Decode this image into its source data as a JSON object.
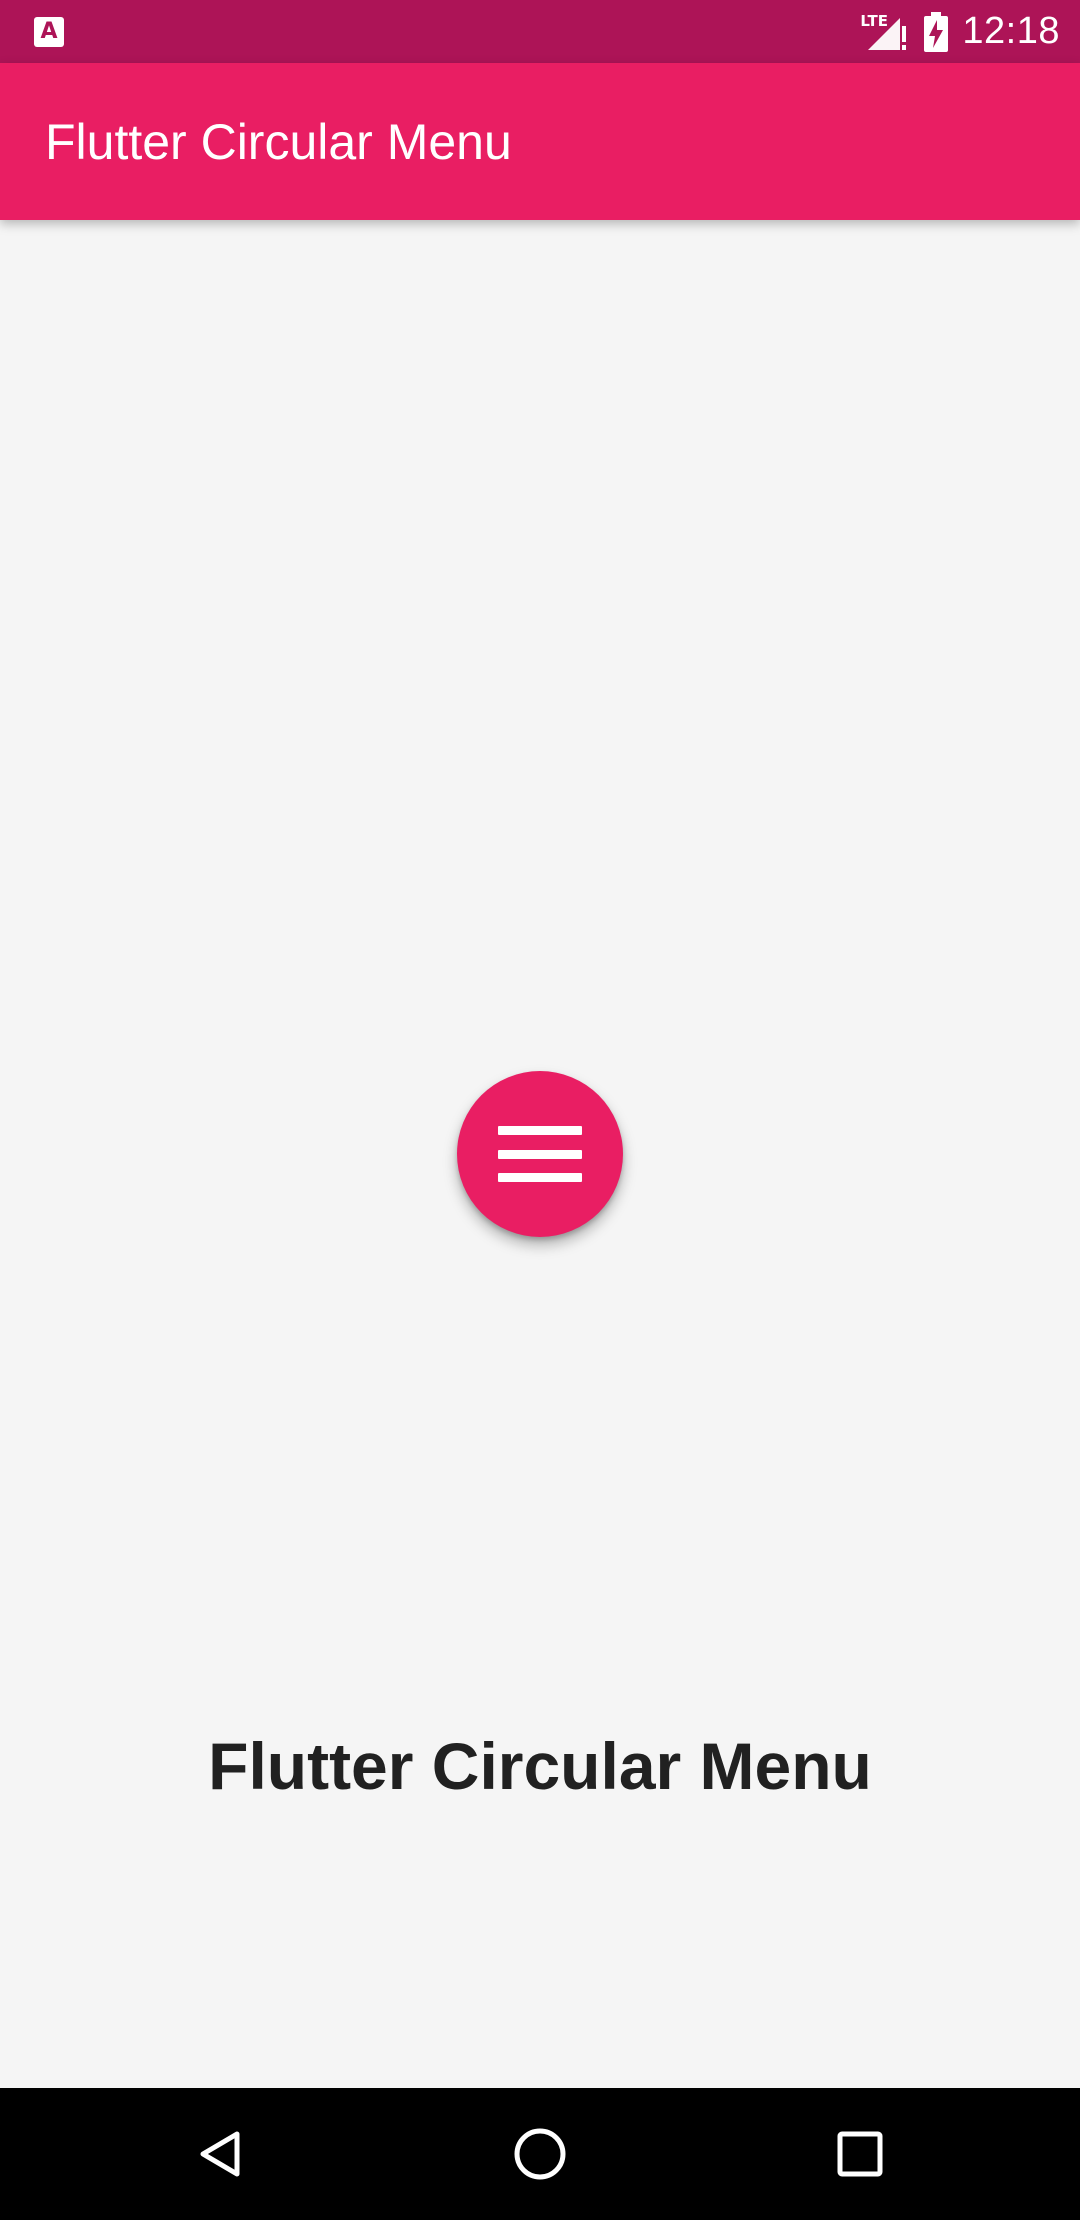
{
  "status_bar": {
    "left_icon": "a-notification-icon",
    "left_icon_glyph": "A",
    "network_label": "LTE",
    "signal_icon": "signal-icon",
    "battery_icon": "battery-charging-icon",
    "time": "12:18"
  },
  "app_bar": {
    "title": "Flutter Circular Menu"
  },
  "main": {
    "fab_icon": "menu-icon",
    "title": "Flutter Circular Menu"
  },
  "nav_bar": {
    "back_icon": "back-icon",
    "home_icon": "home-icon",
    "recents_icon": "recents-icon"
  },
  "colors": {
    "status_bar": "#ad1457",
    "primary": "#e91e63",
    "background": "#f5f5f5",
    "body_text": "#212121",
    "nav_bar": "#000000"
  }
}
